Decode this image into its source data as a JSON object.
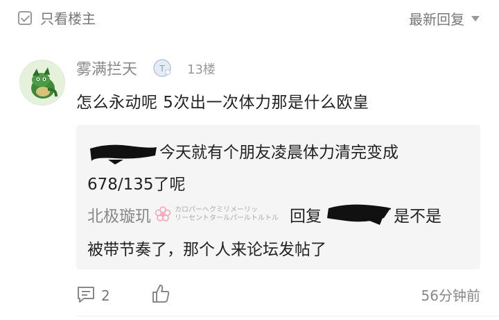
{
  "header": {
    "only_op_label": "只看楼主",
    "sort_label": "最新回复"
  },
  "post": {
    "username": "雾满拦天",
    "level_badge": "T",
    "floor": "13楼",
    "content": "怎么永动呢 5次出一次体力那是什么欧皇",
    "quote": {
      "line1": "今天就有个朋友凌晨体力清完变成",
      "line2": "678/135了呢",
      "reply_user": "北极璇玑",
      "tagline_1": "カロパーヘクミリメーリッ",
      "tagline_2": "リーセントタールパールトルトル",
      "reply_word": "回复",
      "line3_tail": "是不是",
      "line4": "被带节奏了，那个人来论坛发帖了"
    },
    "comment_count": "2",
    "time": "56分钟前"
  },
  "colors": {
    "muted_text": "#888888",
    "quote_bg": "#f5f5f5"
  },
  "icons": [
    "checkbox-icon",
    "caret-down-icon",
    "level-badge-icon",
    "flower-icon",
    "comment-icon",
    "thumbs-up-icon"
  ]
}
